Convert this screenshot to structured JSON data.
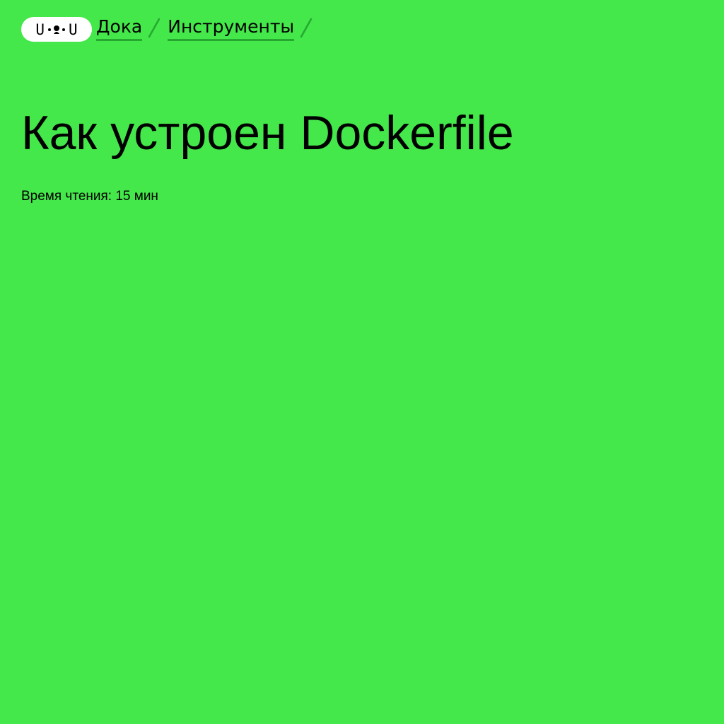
{
  "header": {
    "logo": {
      "left_glyph": "U",
      "right_glyph": "U",
      "icon": "doka-face-logo-icon"
    },
    "breadcrumbs": [
      {
        "label": "Дока"
      },
      {
        "label": "Инструменты"
      }
    ],
    "separator_icon": "slash-separator-icon"
  },
  "article": {
    "title": "Как устроен Dockerfile",
    "reading_time": "Время чтения: 15 мин"
  },
  "colors": {
    "background": "#44e84a",
    "link_underline": "#26a830",
    "text": "#000000",
    "logo_bg": "#ffffff"
  }
}
